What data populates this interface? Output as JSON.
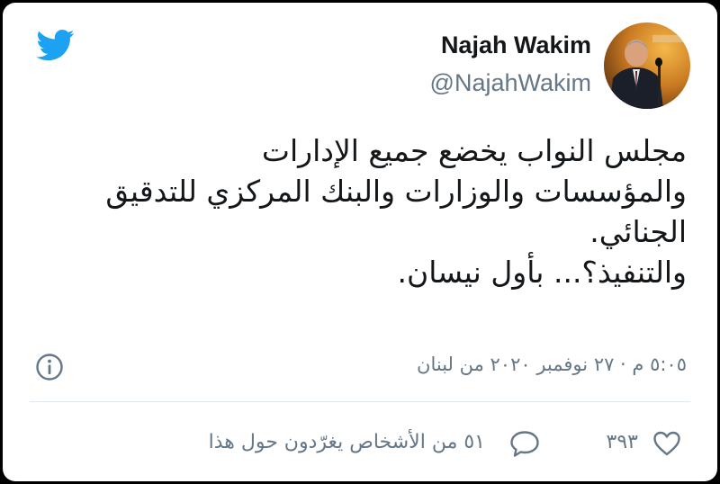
{
  "brand": {
    "icon": "twitter-bird-icon",
    "color": "#1da1f2"
  },
  "author": {
    "display_name": "Najah Wakim",
    "handle": "@NajahWakim",
    "avatar_icon": "avatar"
  },
  "tweet": {
    "lines": [
      "مجلس النواب يخضع جميع الإدارات",
      "والمؤسسات والوزارات والبنك المركزي للتدقيق",
      "الجنائي.",
      "والتنفيذ؟... بأول نيسان."
    ],
    "meta": "٥:٠٥ م · ٢٧ نوفمبر ٢٠٢٠ من لبنان",
    "info_icon": "info-icon"
  },
  "actions": {
    "like_icon": "heart-icon",
    "like_count": "٣٩٣",
    "reply_icon": "speech-bubble-icon",
    "talking_text": "٥١ من الأشخاص يغرّدون حول هذا"
  },
  "colors": {
    "text": "#14171a",
    "secondary": "#657786",
    "divider": "#e1e8ed"
  }
}
